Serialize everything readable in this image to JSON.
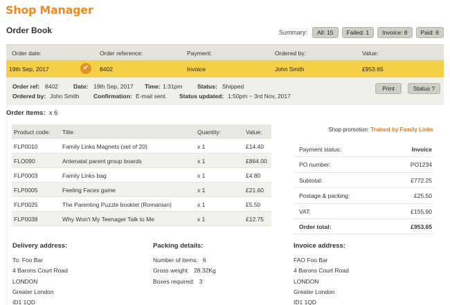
{
  "app": {
    "title": "Shop Manager"
  },
  "page": {
    "title": "Order Book"
  },
  "summary": {
    "label": "Summary:",
    "filters": [
      {
        "label": "All: 15"
      },
      {
        "label": "Failed: 1"
      },
      {
        "label": "Invoice: 8"
      },
      {
        "label": "Paid: 6"
      }
    ]
  },
  "order_list": {
    "headers": {
      "date": "Order date:",
      "reference": "Order reference:",
      "payment": "Payment:",
      "ordered_by": "Ordered by:",
      "value": "Value:"
    },
    "row": {
      "date": "19th Sep, 2017",
      "status_icon": "check-icon",
      "reference": "8402",
      "payment": "Invoice",
      "ordered_by": "John Smith",
      "value": "£953.65"
    }
  },
  "order_detail": {
    "ref_label": "Order ref:",
    "ref_value": "8402",
    "date_label": "Date:",
    "date_value": "19th Sep, 2017",
    "time_label": "Time:",
    "time_value": "1:31pm",
    "status_label": "Status:",
    "status_value": "Shipped",
    "ordered_by_label": "Ordered by:",
    "ordered_by_value": "John Smith",
    "confirmation_label": "Confirmation:",
    "confirmation_value": "E-mail sent.",
    "status_updated_label": "Status updated:",
    "status_updated_value": "1:50pm ~ 3rd Nov, 2017",
    "print_label": "Print",
    "status_button_label": "Status ?"
  },
  "items": {
    "title": "Order items:",
    "count": "x 6",
    "columns": {
      "code": "Product code:",
      "title": "Title:",
      "quantity": "Quantity:",
      "value": "Value:"
    },
    "rows": [
      {
        "code": "FLP0010",
        "title": "Family Links Magnets (set of 20)",
        "quantity": "x 1",
        "value": "£14.40"
      },
      {
        "code": "FLO090",
        "title": "Antenatal parent group boards",
        "quantity": "x 1",
        "value": "£864.00"
      },
      {
        "code": "FLP0003",
        "title": "Family Links bag",
        "quantity": "x 1",
        "value": "£4.80"
      },
      {
        "code": "FLP0005",
        "title": "Feeling Faces game",
        "quantity": "x 1",
        "value": "£21.60"
      },
      {
        "code": "FLP0025",
        "title": "The Parenting Puzzle booklet (Romanian)",
        "quantity": "x 1",
        "value": "£5.50"
      },
      {
        "code": "FLP0038",
        "title": "Why Won't My Teenager Talk to Me",
        "quantity": "x 1",
        "value": "£12.75"
      }
    ]
  },
  "promotion": {
    "label": "Shop promotion:",
    "value": "Trained by Family Links"
  },
  "payment": {
    "rows": [
      {
        "label": "Payment status:",
        "value": "Invoice"
      },
      {
        "label": "PO number:",
        "value": "PO1234"
      },
      {
        "label": "Subtotal:",
        "value": "£772.25"
      },
      {
        "label": "Postage & packing:",
        "value": "£25.50"
      },
      {
        "label": "VAT:",
        "value": "£155.90"
      },
      {
        "label": "Order total:",
        "value": "£953.65"
      }
    ]
  },
  "delivery": {
    "title": "Delivery address:",
    "lines": [
      "To: Foo Bar",
      "4 Barons Court Road",
      "LONDON",
      "Greater London",
      "ID1 1QD"
    ]
  },
  "packing": {
    "title": "Packing details:",
    "rows": [
      {
        "label": "Number of items:",
        "value": "6"
      },
      {
        "label": "Gross weight:",
        "value": "28.32Kg"
      },
      {
        "label": "Boxes required:",
        "value": "3"
      }
    ]
  },
  "invoice": {
    "title": "Invoice address:",
    "lines": [
      "FAO Foo Bar",
      "4 Barons Court Road",
      "LONDON",
      "Greater London",
      "ID1 1QD"
    ]
  },
  "colors": {
    "brand": "#f08a1c",
    "highlight_row": "#f5d046",
    "check": "#e0932b",
    "promo": "#e0781a"
  }
}
